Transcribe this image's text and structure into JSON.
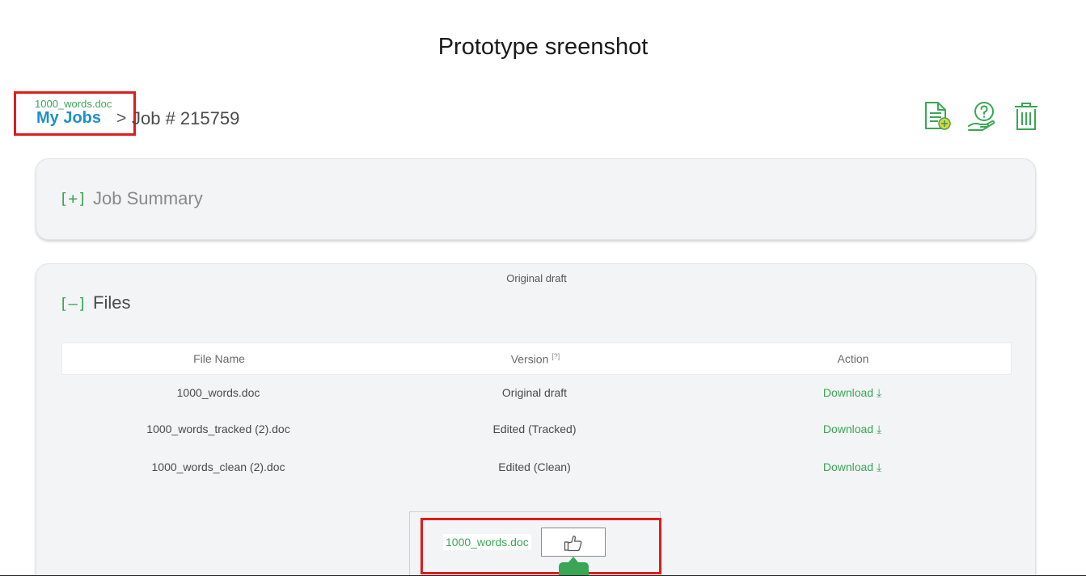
{
  "page": {
    "title": "Prototype sreenshot"
  },
  "breadcrumb": {
    "file_label": "1000_words.doc",
    "my_jobs": "My Jobs",
    "separator": ">",
    "job": "Job # 215759"
  },
  "toolbar": {
    "icons": [
      "add-document-icon",
      "help-hand-icon",
      "trash-icon"
    ],
    "accent": "#3aa655",
    "badge_color": "#e5d23a"
  },
  "summary": {
    "toggle": "[+]",
    "title": "Job Summary"
  },
  "files": {
    "toggle": "[–]",
    "title": "Files",
    "top_label": "Original draft",
    "columns": {
      "file_name": "File Name",
      "version": "Version",
      "version_help": "[?]",
      "action": "Action"
    },
    "rows": [
      {
        "name": "1000_words.doc",
        "version": "Original draft",
        "action": "Download ⤓"
      },
      {
        "name": "1000_words_tracked (2).doc",
        "version": "Edited (Tracked)",
        "action": "Download ⤓"
      },
      {
        "name": "1000_words_clean (2).doc",
        "version": "Edited (Clean)",
        "action": "Download ⤓"
      }
    ]
  },
  "notice": {
    "file": "1000_words.doc",
    "button_icon": "thumbs-up-icon"
  },
  "colors": {
    "link_blue": "#1c90c9",
    "green": "#3aa655",
    "highlight_red": "#e01b1b"
  }
}
